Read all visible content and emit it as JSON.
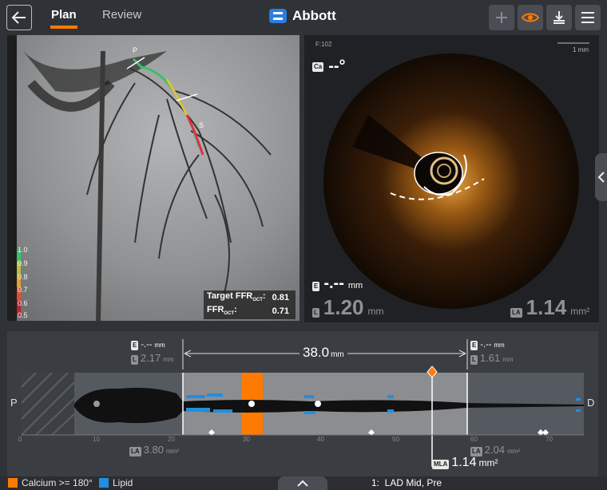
{
  "header": {
    "tabs": [
      {
        "label": "Plan",
        "active": true
      },
      {
        "label": "Review",
        "active": false
      }
    ],
    "brand": "Abbott",
    "accent_color": "#ff7a00",
    "tools": [
      "plus-icon",
      "eye-icon",
      "download-icon",
      "menu-icon"
    ]
  },
  "angio": {
    "markers": {
      "proximal": "P",
      "distal": "S"
    },
    "ffr_scale": [
      "1.0",
      "0.9",
      "0.8",
      "0.7",
      "0.6",
      "0.5"
    ],
    "target_ffr_label": "Target FFR",
    "ffr_label": "FFR",
    "ffr_subscript": "OCT",
    "target_ffr_value": "0.81",
    "ffr_value": "0.71"
  },
  "oct": {
    "frame": "F:102",
    "scale_label": "1 mm",
    "angle_value": "--°",
    "angle_badge": "Ca",
    "e_value": "-.--",
    "e_unit": "mm",
    "l_value": "1.20",
    "l_unit": "mm",
    "la_value": "1.14",
    "la_unit": "mm²"
  },
  "lumen": {
    "left_e_value": "-.--",
    "left_e_unit": "mm",
    "left_l_value": "2.17",
    "left_l_unit": "mm",
    "right_e_value": "-.--",
    "right_e_unit": "mm",
    "right_l_value": "1.61",
    "right_l_unit": "mm",
    "length_value": "38.0",
    "length_unit": "mm",
    "proximal_label": "P",
    "distal_label": "D",
    "axis_ticks": [
      "0",
      "10",
      "20",
      "30",
      "40",
      "50",
      "60",
      "70"
    ],
    "left_la_value": "3.80",
    "left_la_unit": "mm²",
    "right_la_value": "2.04",
    "right_la_unit": "mm²",
    "mla_badge": "MLA",
    "mla_value": "1.14",
    "mla_unit": "mm²"
  },
  "legend": {
    "calcium_label": "Calcium >= 180°",
    "calcium_color": "#ff7a00",
    "lipid_label": "Lipid",
    "lipid_color": "#1f8fe0"
  },
  "status": {
    "vessel_label": "1:  LAD Mid, Pre"
  }
}
